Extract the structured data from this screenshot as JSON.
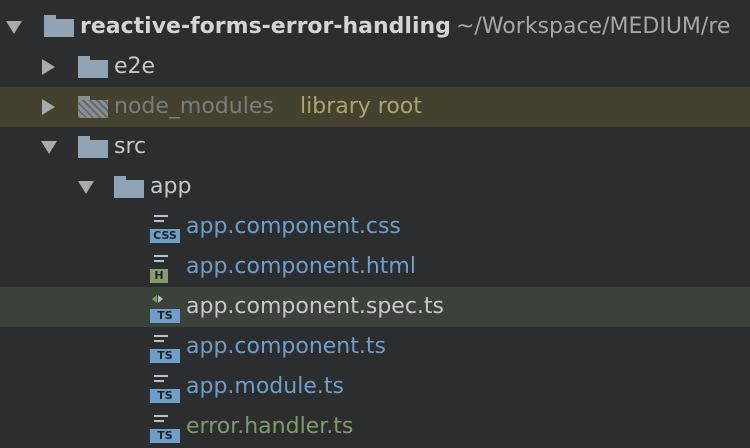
{
  "colors": {
    "background": "#2b2d2f",
    "excluded_row": "#45412f",
    "selected_row": "#3a4239",
    "folder": "#8fa3b5",
    "file_blue": "#6f9fc9",
    "file_green": "#7f9c6a"
  },
  "project": {
    "name": "reactive-forms-error-handling",
    "path": "~/Workspace/MEDIUM/re",
    "expanded": true
  },
  "tree": {
    "e2e": {
      "label": "e2e",
      "expanded": false,
      "icon": "folder-icon"
    },
    "node_modules": {
      "label": "node_modules",
      "hint": "library root",
      "expanded": false,
      "icon": "excluded-folder-icon"
    },
    "src": {
      "label": "src",
      "expanded": true,
      "icon": "folder-icon"
    },
    "app": {
      "label": "app",
      "expanded": true,
      "icon": "folder-icon"
    },
    "files": [
      {
        "label": "app.component.css",
        "badge": "CSS",
        "badge_color": "#6f9fc9",
        "icon": "css-file-icon"
      },
      {
        "label": "app.component.html",
        "badge": "H",
        "badge_color": "#8a9a6a",
        "icon": "html-file-icon"
      },
      {
        "label": "app.component.spec.ts",
        "badge": "TS",
        "badge_color": "#6f9fc9",
        "icon": "test-ts-file-icon"
      },
      {
        "label": "app.component.ts",
        "badge": "TS",
        "badge_color": "#6f9fc9",
        "icon": "ts-file-icon"
      },
      {
        "label": "app.module.ts",
        "badge": "TS",
        "badge_color": "#6f9fc9",
        "icon": "ts-file-icon"
      },
      {
        "label": "error.handler.ts",
        "badge": "TS",
        "badge_color": "#6f9fc9",
        "icon": "ts-file-icon"
      }
    ]
  }
}
